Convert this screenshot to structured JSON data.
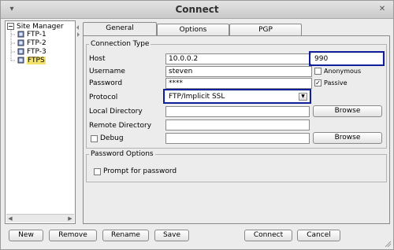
{
  "window": {
    "title": "Connect"
  },
  "tree": {
    "root_label": "Site Manager",
    "items": [
      {
        "label": "FTP-1"
      },
      {
        "label": "FTP-2"
      },
      {
        "label": "FTP-3"
      },
      {
        "label": "FTPS",
        "selected": true
      }
    ]
  },
  "tabs": [
    {
      "label": "General",
      "active": true
    },
    {
      "label": "Options"
    },
    {
      "label": "PGP"
    }
  ],
  "connection": {
    "group_title": "Connection Type",
    "host_label": "Host",
    "host_value": "10.0.0.2",
    "port_value": "990",
    "username_label": "Username",
    "username_value": "steven",
    "anonymous_label": "Anonymous",
    "anonymous_checked": false,
    "password_label": "Password",
    "password_value": "****",
    "passive_label": "Passive",
    "passive_checked": true,
    "protocol_label": "Protocol",
    "protocol_value": "FTP/Implicit SSL",
    "local_dir_label": "Local Directory",
    "local_dir_value": "",
    "remote_dir_label": "Remote Directory",
    "remote_dir_value": "",
    "debug_label": "Debug",
    "debug_checked": false,
    "debug_value": "",
    "browse_label": "Browse"
  },
  "password_options": {
    "group_title": "Password Options",
    "prompt_label": "Prompt for password",
    "prompt_checked": false
  },
  "buttons": {
    "new": "New",
    "remove": "Remove",
    "rename": "Rename",
    "save": "Save",
    "connect": "Connect",
    "cancel": "Cancel"
  },
  "colors": {
    "focus_border": "#10209a",
    "selection": "#f3e26a"
  }
}
